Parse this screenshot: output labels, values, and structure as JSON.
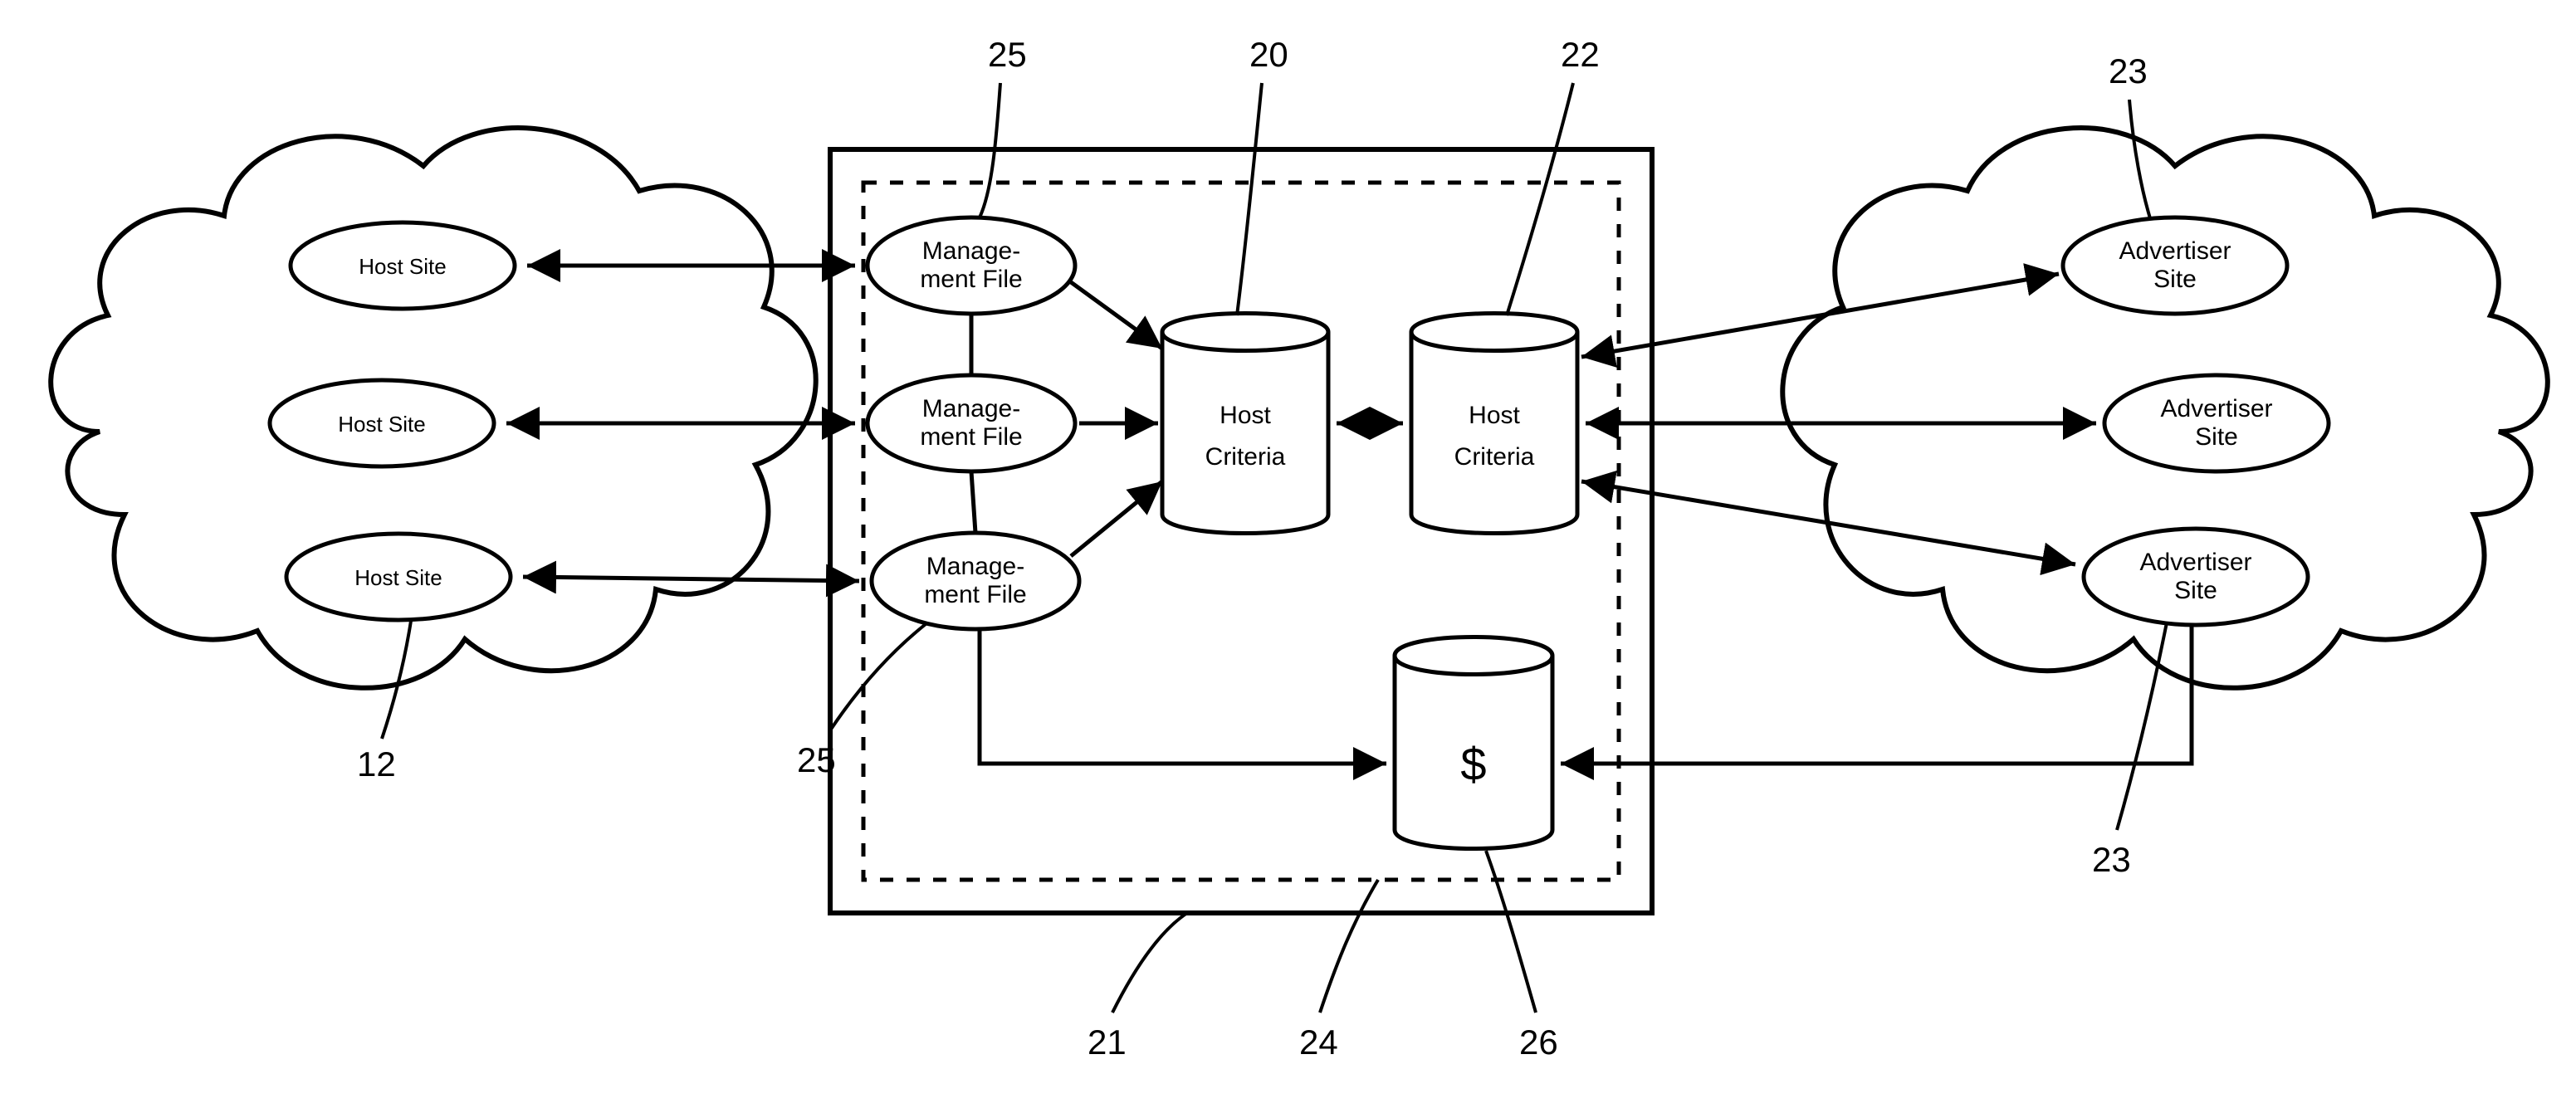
{
  "refs": {
    "r25a": "25",
    "r25b": "25",
    "r20": "20",
    "r22": "22",
    "r23a": "23",
    "r23b": "23",
    "r12": "12",
    "r21": "21",
    "r24": "24",
    "r26": "26"
  },
  "nodes": {
    "host_site_1": "Host Site",
    "host_site_2": "Host Site",
    "host_site_3": "Host Site",
    "mgmt1_l1": "Manage-",
    "mgmt1_l2": "ment File",
    "mgmt2_l1": "Manage-",
    "mgmt2_l2": "ment File",
    "mgmt3_l1": "Manage-",
    "mgmt3_l2": "ment File",
    "host_crit_l1": "Host",
    "host_crit_l2": "Criteria",
    "host_crit2_l1": "Host",
    "host_crit2_l2": "Criteria",
    "adv1_l1": "Advertiser",
    "adv1_l2": "Site",
    "adv2_l1": "Advertiser",
    "adv2_l2": "Site",
    "adv3_l1": "Advertiser",
    "adv3_l2": "Site",
    "dollar": "$"
  }
}
